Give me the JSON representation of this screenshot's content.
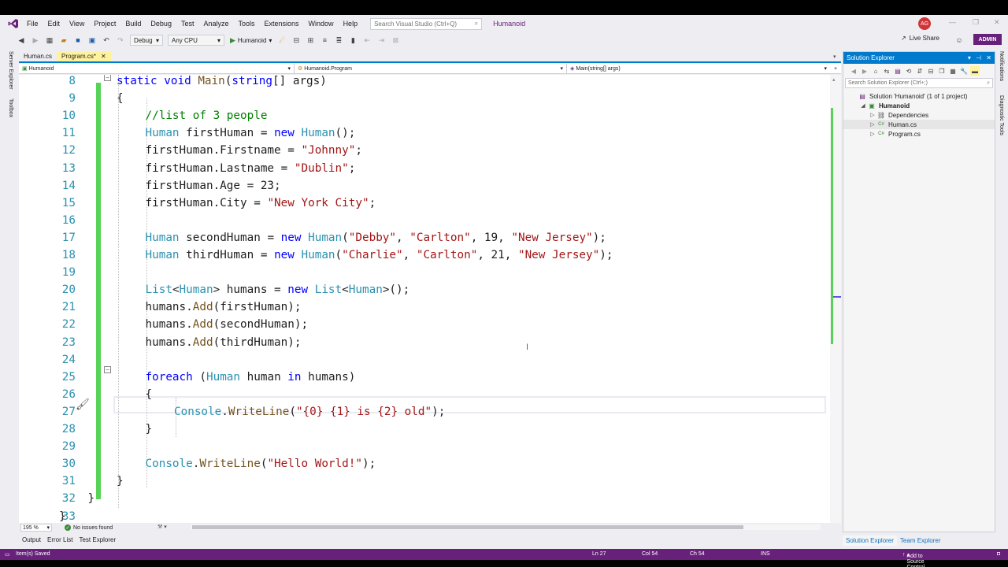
{
  "menu": {
    "items": [
      "File",
      "Edit",
      "View",
      "Project",
      "Build",
      "Debug",
      "Test",
      "Analyze",
      "Tools",
      "Extensions",
      "Window",
      "Help"
    ],
    "search_placeholder": "Search Visual Studio (Ctrl+Q)",
    "window_title": "Humanoid",
    "avatar_initials": "AG"
  },
  "toolbar": {
    "config": "Debug",
    "platform": "Any CPU",
    "run_label": "Humanoid",
    "live_share": "Live Share",
    "admin": "ADMIN"
  },
  "left_strip": {
    "server_explorer": "Server Explorer",
    "toolbox": "Toolbox"
  },
  "right_strip": {
    "notifications": "Notifications",
    "diagnostic_tools": "Diagnostic Tools"
  },
  "tabs": [
    {
      "label": "Human.cs",
      "active": false
    },
    {
      "label": "Program.cs*",
      "active": true
    }
  ],
  "navbar": {
    "project": "Humanoid",
    "class": "Humanoid.Program",
    "member": "Main(string[] args)"
  },
  "code_lines": [
    {
      "n": "8",
      "indent": 2,
      "tokens": [
        [
          "k",
          "static "
        ],
        [
          "k",
          "void "
        ],
        [
          "m",
          "Main"
        ],
        [
          "d",
          "("
        ],
        [
          "k",
          "string"
        ],
        [
          "d",
          "[] args)"
        ]
      ]
    },
    {
      "n": "9",
      "indent": 2,
      "tokens": [
        [
          "d",
          "{"
        ]
      ]
    },
    {
      "n": "10",
      "indent": 3,
      "tokens": [
        [
          "c",
          "//list of 3 people"
        ]
      ]
    },
    {
      "n": "11",
      "indent": 3,
      "tokens": [
        [
          "t",
          "Human"
        ],
        [
          "d",
          " firstHuman = "
        ],
        [
          "k",
          "new "
        ],
        [
          "t",
          "Human"
        ],
        [
          "d",
          "();"
        ]
      ]
    },
    {
      "n": "12",
      "indent": 3,
      "tokens": [
        [
          "d",
          "firstHuman.Firstname = "
        ],
        [
          "s",
          "\"Johnny\""
        ],
        [
          "d",
          ";"
        ]
      ]
    },
    {
      "n": "13",
      "indent": 3,
      "tokens": [
        [
          "d",
          "firstHuman.Lastname = "
        ],
        [
          "s",
          "\"Dublin\""
        ],
        [
          "d",
          ";"
        ]
      ]
    },
    {
      "n": "14",
      "indent": 3,
      "tokens": [
        [
          "d",
          "firstHuman.Age = 23;"
        ]
      ]
    },
    {
      "n": "15",
      "indent": 3,
      "tokens": [
        [
          "d",
          "firstHuman.City = "
        ],
        [
          "s",
          "\"New York City\""
        ],
        [
          "d",
          ";"
        ]
      ]
    },
    {
      "n": "16",
      "indent": 3,
      "tokens": []
    },
    {
      "n": "17",
      "indent": 3,
      "tokens": [
        [
          "t",
          "Human"
        ],
        [
          "d",
          " secondHuman = "
        ],
        [
          "k",
          "new "
        ],
        [
          "t",
          "Human"
        ],
        [
          "d",
          "("
        ],
        [
          "s",
          "\"Debby\""
        ],
        [
          "d",
          ", "
        ],
        [
          "s",
          "\"Carlton\""
        ],
        [
          "d",
          ", 19, "
        ],
        [
          "s",
          "\"New Jersey\""
        ],
        [
          "d",
          ");"
        ]
      ]
    },
    {
      "n": "18",
      "indent": 3,
      "tokens": [
        [
          "t",
          "Human"
        ],
        [
          "d",
          " thirdHuman = "
        ],
        [
          "k",
          "new "
        ],
        [
          "t",
          "Human"
        ],
        [
          "d",
          "("
        ],
        [
          "s",
          "\"Charlie\""
        ],
        [
          "d",
          ", "
        ],
        [
          "s",
          "\"Carlton\""
        ],
        [
          "d",
          ", 21, "
        ],
        [
          "s",
          "\"New Jersey\""
        ],
        [
          "d",
          ");"
        ]
      ]
    },
    {
      "n": "19",
      "indent": 3,
      "tokens": []
    },
    {
      "n": "20",
      "indent": 3,
      "tokens": [
        [
          "t",
          "List"
        ],
        [
          "d",
          "<"
        ],
        [
          "t",
          "Human"
        ],
        [
          "d",
          "> humans = "
        ],
        [
          "k",
          "new "
        ],
        [
          "t",
          "List"
        ],
        [
          "d",
          "<"
        ],
        [
          "t",
          "Human"
        ],
        [
          "d",
          ">();"
        ]
      ]
    },
    {
      "n": "21",
      "indent": 3,
      "tokens": [
        [
          "d",
          "humans."
        ],
        [
          "m",
          "Add"
        ],
        [
          "d",
          "(firstHuman);"
        ]
      ]
    },
    {
      "n": "22",
      "indent": 3,
      "tokens": [
        [
          "d",
          "humans."
        ],
        [
          "m",
          "Add"
        ],
        [
          "d",
          "(secondHuman);"
        ]
      ]
    },
    {
      "n": "23",
      "indent": 3,
      "tokens": [
        [
          "d",
          "humans."
        ],
        [
          "m",
          "Add"
        ],
        [
          "d",
          "(thirdHuman);"
        ]
      ]
    },
    {
      "n": "24",
      "indent": 3,
      "tokens": []
    },
    {
      "n": "25",
      "indent": 3,
      "tokens": [
        [
          "k",
          "foreach "
        ],
        [
          "d",
          "("
        ],
        [
          "t",
          "Human"
        ],
        [
          "d",
          " human "
        ],
        [
          "k",
          "in"
        ],
        [
          "d",
          " humans)"
        ]
      ]
    },
    {
      "n": "26",
      "indent": 3,
      "tokens": [
        [
          "d",
          "{"
        ]
      ]
    },
    {
      "n": "27",
      "indent": 4,
      "tokens": [
        [
          "t",
          "Console"
        ],
        [
          "d",
          "."
        ],
        [
          "m",
          "WriteLine"
        ],
        [
          "d",
          "("
        ],
        [
          "s",
          "\"{0} {1} is {2} old\""
        ],
        [
          "d",
          ");"
        ]
      ]
    },
    {
      "n": "28",
      "indent": 3,
      "tokens": [
        [
          "d",
          "}"
        ]
      ]
    },
    {
      "n": "29",
      "indent": 3,
      "tokens": []
    },
    {
      "n": "30",
      "indent": 3,
      "tokens": [
        [
          "t",
          "Console"
        ],
        [
          "d",
          "."
        ],
        [
          "m",
          "WriteLine"
        ],
        [
          "d",
          "("
        ],
        [
          "s",
          "\"Hello World!\""
        ],
        [
          "d",
          ");"
        ]
      ]
    },
    {
      "n": "31",
      "indent": 2,
      "tokens": [
        [
          "d",
          "}"
        ]
      ]
    },
    {
      "n": "32",
      "indent": 1,
      "tokens": [
        [
          "d",
          "}"
        ]
      ]
    },
    {
      "n": "33",
      "indent": 0,
      "tokens": [
        [
          "d",
          "}"
        ]
      ]
    }
  ],
  "editor_bottom": {
    "zoom": "195 %",
    "issues": "No issues found"
  },
  "solution_explorer": {
    "title": "Solution Explorer",
    "search_placeholder": "Search Solution Explorer (Ctrl+;)",
    "tree": [
      {
        "label": "Solution 'Humanoid' (1 of 1 project)",
        "level": 0,
        "exp": "",
        "icon": "solution",
        "bold": false,
        "selected": false
      },
      {
        "label": "Humanoid",
        "level": 1,
        "exp": "◢",
        "icon": "project",
        "bold": true,
        "selected": false
      },
      {
        "label": "Dependencies",
        "level": 2,
        "exp": "▷",
        "icon": "dependencies",
        "bold": false,
        "selected": false
      },
      {
        "label": "Human.cs",
        "level": 2,
        "exp": "▷",
        "icon": "csharp-file",
        "bold": false,
        "selected": true
      },
      {
        "label": "Program.cs",
        "level": 2,
        "exp": "▷",
        "icon": "csharp-file",
        "bold": false,
        "selected": false
      }
    ],
    "tabs": [
      "Solution Explorer",
      "Team Explorer"
    ]
  },
  "tool_tabs": [
    "Output",
    "Error List",
    "Test Explorer"
  ],
  "statusbar": {
    "message": "Item(s) Saved",
    "line": "Ln 27",
    "col": "Col 54",
    "ch": "Ch 54",
    "mode": "INS",
    "source_control": "Add to Source Control"
  },
  "colors": {
    "accent": "#007acc",
    "statusbar": "#68217a",
    "keyword": "#0000ff",
    "type": "#2b91af",
    "string": "#a31515",
    "comment": "#008000",
    "change_bar": "#57d357"
  }
}
